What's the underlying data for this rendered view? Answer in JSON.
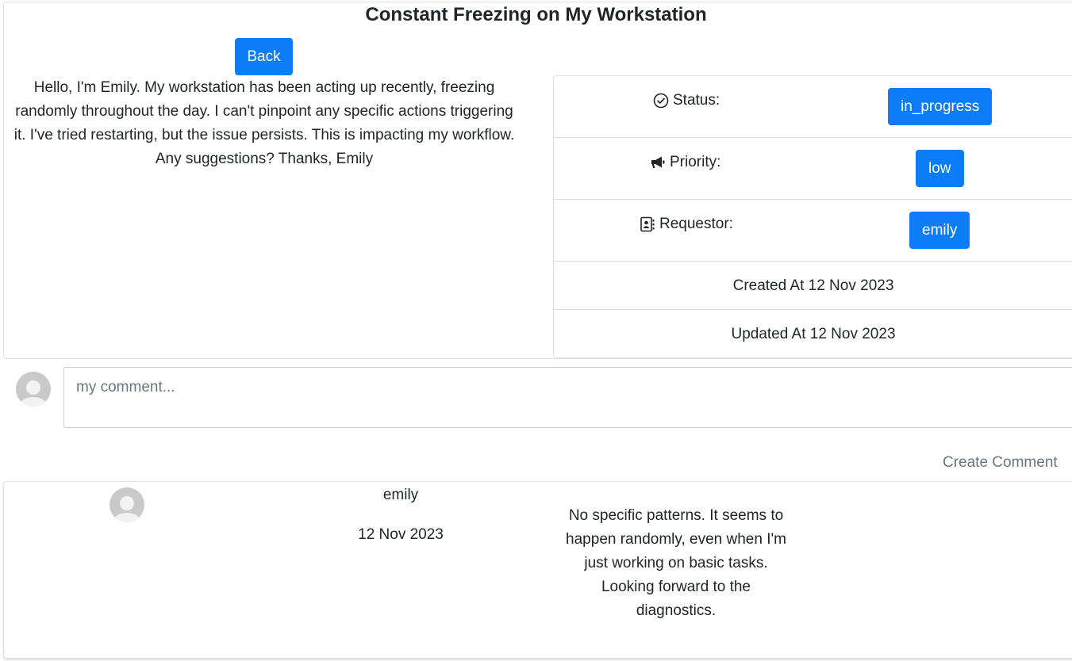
{
  "ticket": {
    "title": "Constant Freezing on My Workstation",
    "back_label": "Back",
    "description": "Hello, I'm Emily. My workstation has been acting up recently, freezing randomly throughout the day. I can't pinpoint any specific actions triggering it. I've tried restarting, but the issue persists. This is impacting my workflow. Any suggestions? Thanks, Emily"
  },
  "info": {
    "status_label": "Status:",
    "status_value": "in_progress",
    "status_icon": "check-circle-icon",
    "priority_label": "Priority:",
    "priority_value": "low",
    "priority_icon": "megaphone-icon",
    "requestor_label": "Requestor:",
    "requestor_value": "emily",
    "requestor_icon": "contact-card-icon",
    "created_at": "Created At 12 Nov 2023",
    "updated_at": "Updated At 12 Nov 2023",
    "badge_color": "#0d7cf7"
  },
  "new_comment": {
    "placeholder": "my comment...",
    "submit_label": "Create Comment"
  },
  "comments": [
    {
      "author": "emily",
      "date": "12 Nov 2023",
      "text": "No specific patterns. It seems to happen randomly, even when I'm just working on basic tasks. Looking forward to the diagnostics."
    }
  ]
}
